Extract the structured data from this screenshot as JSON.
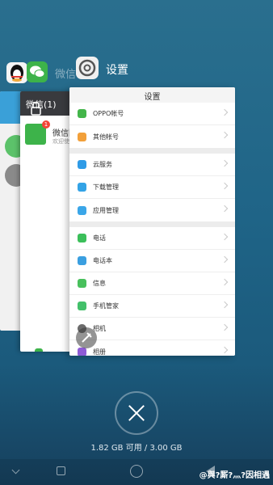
{
  "colors": {
    "accent": "#3aa0d8",
    "wechat_green": "#3db34a",
    "background_top": "#2a6f8e",
    "background_bottom": "#163f5c"
  },
  "recents": {
    "qq": {
      "icon": "qq-penguin-icon"
    },
    "wechat": {
      "icon": "wechat-icon",
      "label": "微信",
      "header": "微信(1)",
      "item_title": "微信团",
      "item_subtitle": "欢迎使",
      "badge": "1",
      "lock_icon": "lock-icon"
    },
    "settings": {
      "icon": "settings-gear-icon",
      "label": "设置"
    }
  },
  "settings_card": {
    "title": "设置",
    "groups": [
      [
        {
          "label": "OPPO帐号",
          "icon": "oppo-account-icon",
          "color": "#43b54a"
        },
        {
          "label": "其他帐号",
          "icon": "other-account-icon",
          "color": "#f2a03a"
        }
      ],
      [
        {
          "label": "云服务",
          "icon": "cloud-icon",
          "color": "#2f9be6"
        },
        {
          "label": "下载管理",
          "icon": "download-icon",
          "color": "#33a3e6"
        },
        {
          "label": "应用管理",
          "icon": "apps-icon",
          "color": "#3aa6e8"
        }
      ],
      [
        {
          "label": "电话",
          "icon": "phone-icon",
          "color": "#3bbf5a"
        },
        {
          "label": "电话本",
          "icon": "contacts-icon",
          "color": "#3a9fe0"
        },
        {
          "label": "信息",
          "icon": "message-icon",
          "color": "#48c05c"
        },
        {
          "label": "手机管家",
          "icon": "phone-manager-icon",
          "color": "#43c06a"
        },
        {
          "label": "相机",
          "icon": "camera-icon",
          "color": "#6b6b6b"
        },
        {
          "label": "相册",
          "icon": "gallery-icon",
          "color": "#8e5bd6"
        }
      ]
    ]
  },
  "clear_button": {
    "icon": "close-icon"
  },
  "memory": "1.82 GB 可用 / 3.00 GB",
  "navbar": {
    "collapse_icon": "chevron-down-icon",
    "menu_icon": "square-icon",
    "home_icon": "circle-icon",
    "back_icon": "triangle-back-icon"
  },
  "watermark": "@與?厮?灬?因相遇"
}
